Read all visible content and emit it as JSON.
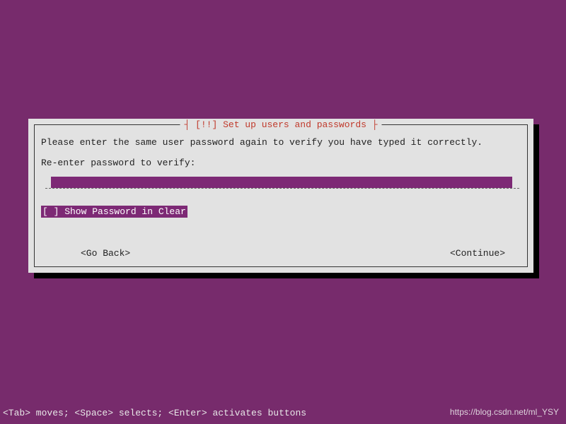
{
  "dialog": {
    "title": "┤ [!!] Set up users and passwords ├",
    "instruction": "Please enter the same user password again to verify you have typed it correctly.",
    "prompt": "Re-enter password to verify:",
    "input_value": "",
    "checkbox_label": "[ ] Show Password in Clear",
    "go_back_label": "<Go Back>",
    "continue_label": "<Continue>"
  },
  "statusbar": {
    "text": "<Tab> moves; <Space> selects; <Enter> activates buttons"
  },
  "watermark": {
    "text": "https://blog.csdn.net/ml_YSY"
  }
}
